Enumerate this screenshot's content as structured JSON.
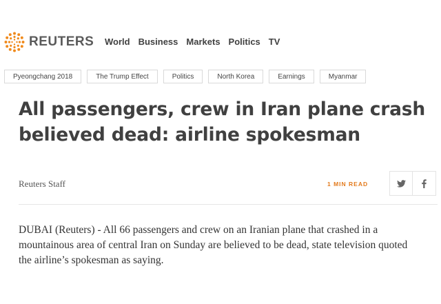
{
  "site": {
    "brand": "REUTERS",
    "nav": [
      "World",
      "Business",
      "Markets",
      "Politics",
      "TV"
    ]
  },
  "topics": [
    "Pyeongchang 2018",
    "The Trump Effect",
    "Politics",
    "North Korea",
    "Earnings",
    "Myanmar"
  ],
  "article": {
    "headline_lines": [
      "All passengers, crew in Iran plane crash",
      "believed dead: airline spokesman"
    ],
    "author": "Reuters Staff",
    "read_time": "1 MIN READ",
    "share_icons": [
      "twitter-icon",
      "facebook-icon"
    ],
    "body_lines": [
      "DUBAI (Reuters) - All 66 passengers and crew on an Iranian plane that crashed in a",
      "mountainous area of central Iran on Sunday are believed to be dead, state television quoted",
      "the airline’s spokesman as saying."
    ]
  },
  "colors": {
    "brand_orange": "#f08a1c",
    "text_dark": "#404040",
    "read_time_orange": "#e37a1c",
    "border": "#d9d9d9"
  }
}
